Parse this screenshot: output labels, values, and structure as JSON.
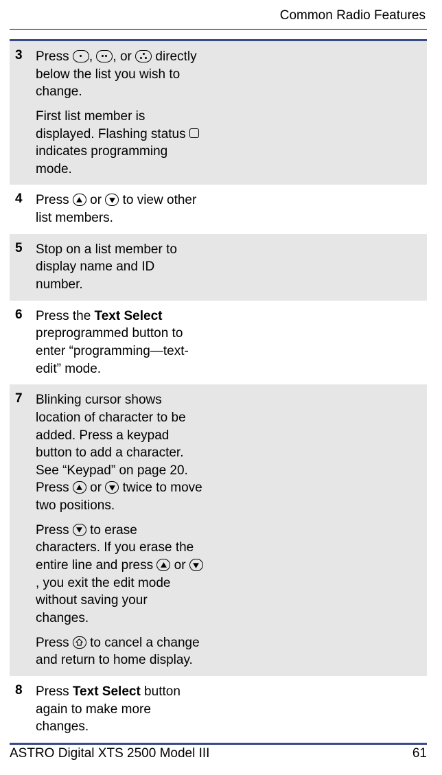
{
  "header": {
    "title": "Common Radio Features"
  },
  "steps": [
    {
      "num": "3",
      "paras": [
        {
          "segments": [
            {
              "t": "Press "
            },
            {
              "icon": "dot1"
            },
            {
              "t": ", "
            },
            {
              "icon": "dot2"
            },
            {
              "t": ", or "
            },
            {
              "icon": "tri"
            },
            {
              "t": " directly below the list you wish to change."
            }
          ]
        },
        {
          "segments": [
            {
              "t": "First list member is displayed. Flashing status "
            },
            {
              "icon": "square"
            },
            {
              "t": " indicates programming mode."
            }
          ]
        }
      ],
      "gray": true
    },
    {
      "num": "4",
      "paras": [
        {
          "segments": [
            {
              "t": "Press "
            },
            {
              "icon": "up"
            },
            {
              "t": " or "
            },
            {
              "icon": "down"
            },
            {
              "t": " to view other list members."
            }
          ]
        }
      ],
      "gray": false
    },
    {
      "num": "5",
      "paras": [
        {
          "segments": [
            {
              "t": "Stop on a list member to display name and ID number."
            }
          ]
        }
      ],
      "gray": true
    },
    {
      "num": "6",
      "paras": [
        {
          "segments": [
            {
              "t": "Press the "
            },
            {
              "bold": "Text Select"
            },
            {
              "t": " preprogrammed button to enter “programming—text-edit” mode."
            }
          ]
        }
      ],
      "gray": false
    },
    {
      "num": "7",
      "paras": [
        {
          "segments": [
            {
              "t": "Blinking cursor shows location of character to be added. Press a keypad button to add a character. See “Keypad” on page 20. Press "
            },
            {
              "icon": "up"
            },
            {
              "t": " or "
            },
            {
              "icon": "down"
            },
            {
              "t": " twice to move two positions."
            }
          ]
        },
        {
          "segments": [
            {
              "t": "Press "
            },
            {
              "icon": "down"
            },
            {
              "t": " to erase characters. If you erase the entire line and press "
            },
            {
              "icon": "up"
            },
            {
              "t": " or "
            },
            {
              "icon": "down"
            },
            {
              "t": ", you exit the edit mode without saving your changes."
            }
          ]
        },
        {
          "segments": [
            {
              "t": "Press "
            },
            {
              "icon": "home"
            },
            {
              "t": " to cancel a change and return to home display."
            }
          ]
        }
      ],
      "gray": true
    },
    {
      "num": "8",
      "paras": [
        {
          "segments": [
            {
              "t": "Press "
            },
            {
              "bold": "Text Select"
            },
            {
              "t": " button again to make more changes."
            }
          ]
        }
      ],
      "gray": false
    }
  ],
  "footer": {
    "left": "ASTRO Digital XTS 2500 Model III",
    "right": "61"
  }
}
